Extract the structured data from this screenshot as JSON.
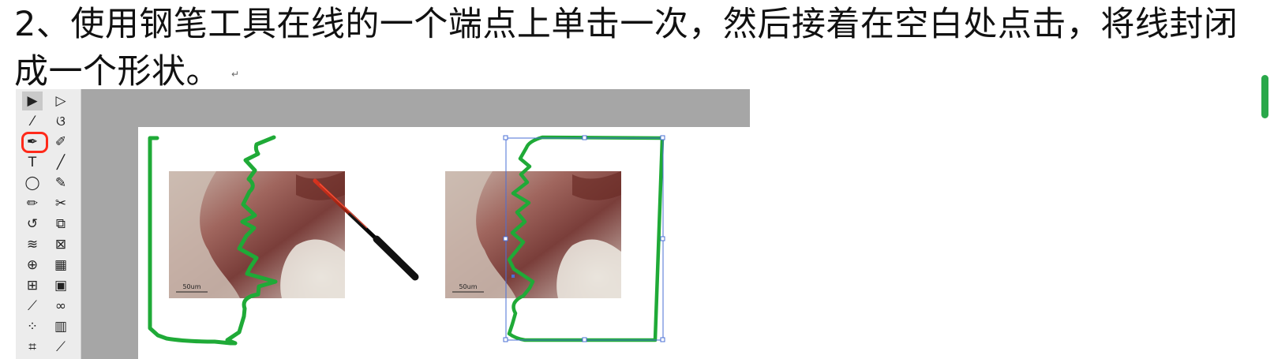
{
  "instruction": {
    "line1": "2、使用钢笔工具在线的一个端点上单击一次，然后接着在空白处点击，将线封闭",
    "line2": "成一个形状。",
    "paragraph_mark": "↵"
  },
  "toolbar": {
    "tools": [
      {
        "name": "selection-tool-icon",
        "glyph": "▶"
      },
      {
        "name": "direct-selection-tool-icon",
        "glyph": "▷"
      },
      {
        "name": "magic-wand-tool-icon",
        "glyph": "⁄"
      },
      {
        "name": "lasso-tool-icon",
        "glyph": "ଓ"
      },
      {
        "name": "pen-tool-icon",
        "glyph": "✒"
      },
      {
        "name": "curvature-tool-icon",
        "glyph": "✐"
      },
      {
        "name": "type-tool-icon",
        "glyph": "T"
      },
      {
        "name": "line-segment-tool-icon",
        "glyph": "╱"
      },
      {
        "name": "ellipse-tool-icon",
        "glyph": "◯"
      },
      {
        "name": "paintbrush-tool-icon",
        "glyph": "✎"
      },
      {
        "name": "pencil-tool-icon",
        "glyph": "✏"
      },
      {
        "name": "scissors-tool-icon",
        "glyph": "✂"
      },
      {
        "name": "rotate-tool-icon",
        "glyph": "↺"
      },
      {
        "name": "scale-tool-icon",
        "glyph": "⧉"
      },
      {
        "name": "width-tool-icon",
        "glyph": "≋"
      },
      {
        "name": "free-transform-tool-icon",
        "glyph": "⊠"
      },
      {
        "name": "shape-builder-tool-icon",
        "glyph": "⊕"
      },
      {
        "name": "perspective-grid-tool-icon",
        "glyph": "▦"
      },
      {
        "name": "mesh-tool-icon",
        "glyph": "⊞"
      },
      {
        "name": "gradient-tool-icon",
        "glyph": "▣"
      },
      {
        "name": "eyedropper-tool-icon",
        "glyph": "⟋"
      },
      {
        "name": "blend-tool-icon",
        "glyph": "∞"
      },
      {
        "name": "symbol-sprayer-tool-icon",
        "glyph": "⁘"
      },
      {
        "name": "column-graph-tool-icon",
        "glyph": "▥"
      },
      {
        "name": "artboard-tool-icon",
        "glyph": "⌗"
      },
      {
        "name": "slice-tool-icon",
        "glyph": "⟋"
      }
    ]
  },
  "canvas": {
    "scale_label_left": "50um",
    "scale_label_right": "50um",
    "stroke_color": "#1faa37",
    "selection_color": "#4a6fd6",
    "highlight_color": "#ff2a1a"
  }
}
